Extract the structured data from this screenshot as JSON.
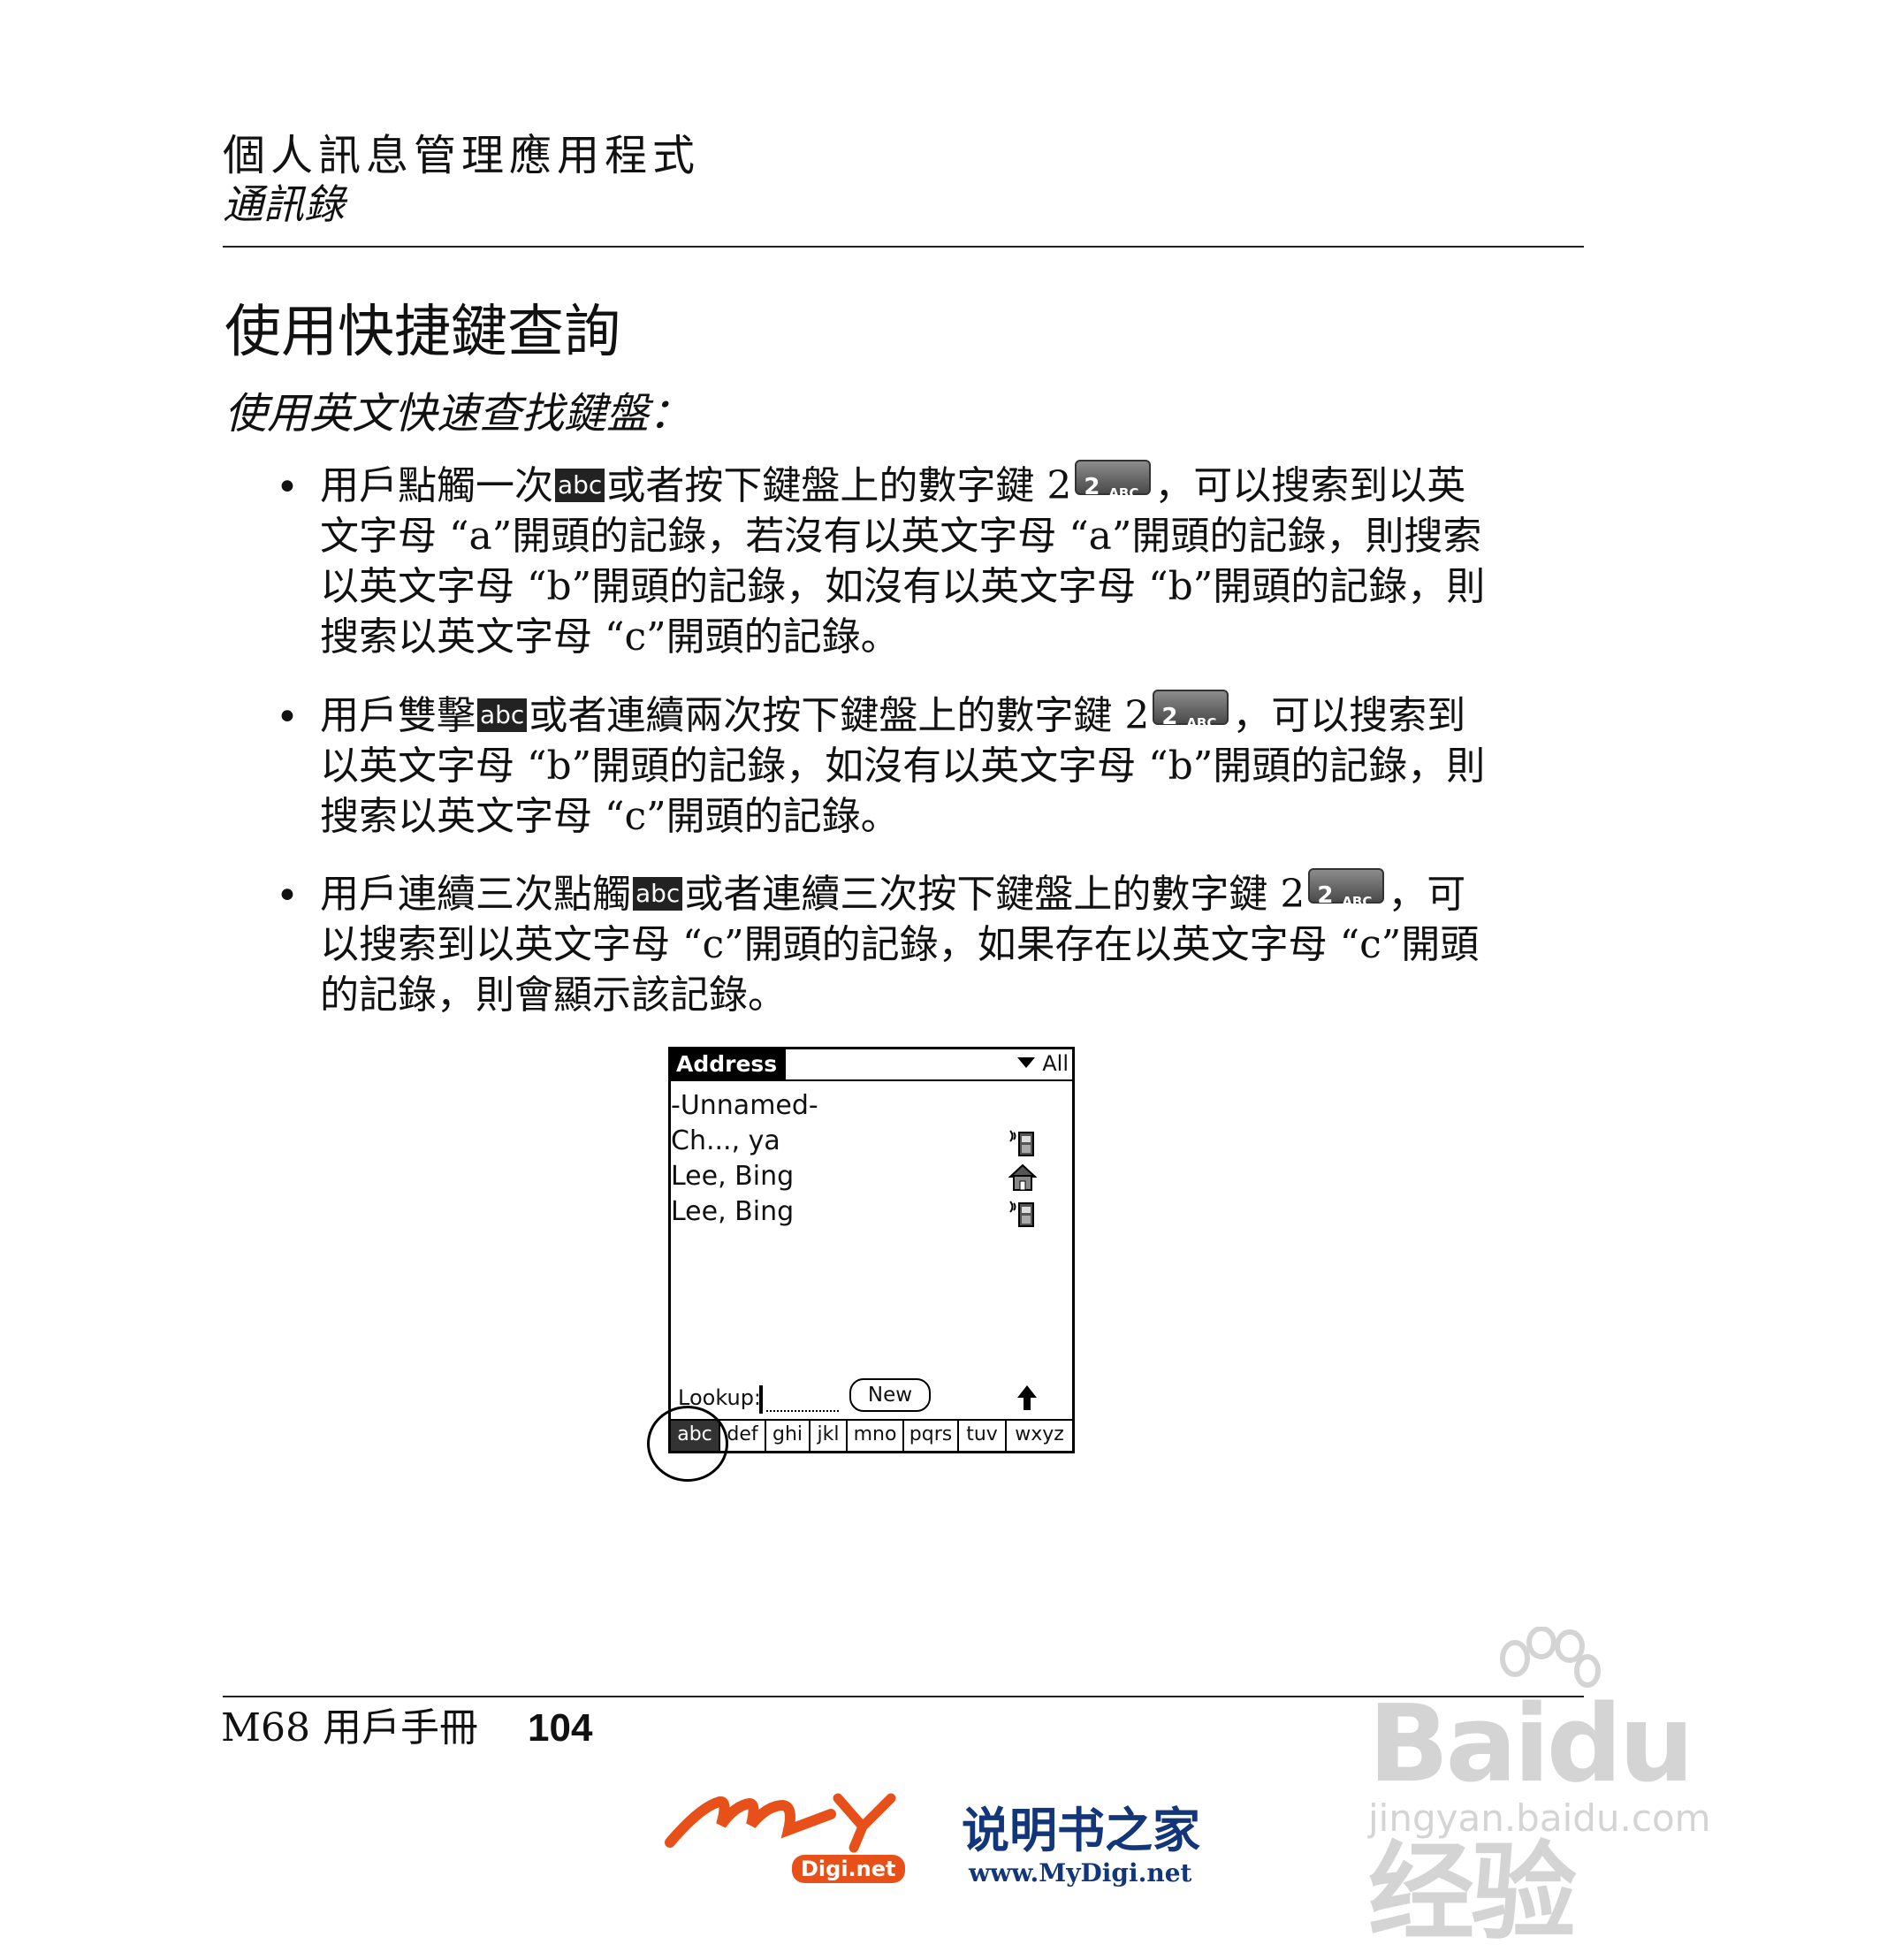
{
  "header": {
    "chapter": "個人訊息管理應用程式",
    "section": "通訊錄"
  },
  "section_title": "使用快捷鍵查詢",
  "subtitle": "使用英文快速查找鍵盤：",
  "keys": {
    "abc": "abc",
    "num2": "2",
    "num2_letters": "ABC"
  },
  "bullets": [
    {
      "a": "用戶點觸一次",
      "b": "或者按下鍵盤上的數字鍵 2",
      "c": "，可以搜索到以英文字母 “a”開頭的記錄，若沒有以英文字母 “a”開頭的記錄，則搜索以英文字母 “b”開頭的記錄，如沒有以英文字母 “b”開頭的記錄，則搜索以英文字母 “c”開頭的記錄。"
    },
    {
      "a": "用戶雙擊",
      "b": "或者連續兩次按下鍵盤上的數字鍵 2",
      "c": "，可以搜索到以英文字母 “b”開頭的記錄，如沒有以英文字母 “b”開頭的記錄，則搜索以英文字母 “c”開頭的記錄。"
    },
    {
      "a": "用戶連續三次點觸",
      "b": "或者連續三次按下鍵盤上的數字鍵 2",
      "c": "，可以搜索到以英文字母 “c”開頭的記錄，如果存在以英文字母 “c”開頭的記錄，則會顯示該記錄。"
    }
  ],
  "device": {
    "title": "Address",
    "category": "All",
    "rows": [
      {
        "name": "-Unnamed-",
        "icon": ""
      },
      {
        "name": "Ch..., ya",
        "icon": "mobile-phone-icon"
      },
      {
        "name": "Lee, Bing",
        "icon": "home-icon"
      },
      {
        "name": "Lee, Bing",
        "icon": "mobile-phone-icon"
      }
    ],
    "lookup_label": "Lookup:",
    "new_button": "New",
    "tabs": [
      "abc",
      "def",
      "ghi",
      "jkl",
      "mno",
      "pqrs",
      "tuv",
      "wxyz"
    ],
    "active_tab": "abc"
  },
  "footer": {
    "manual": "M68 用戶手冊",
    "page": "104"
  },
  "watermark": {
    "text": "Baidu经验",
    "url": "jingyan.baidu.com"
  },
  "logo": {
    "brand": "My",
    "net": "Digi.net",
    "name": "说明书之家",
    "site": "www.MyDigi.net"
  },
  "colors": {
    "logo_orange": "#e8501a",
    "logo_blue": "#13357a",
    "watermark_gray": "#d4d4d4"
  }
}
